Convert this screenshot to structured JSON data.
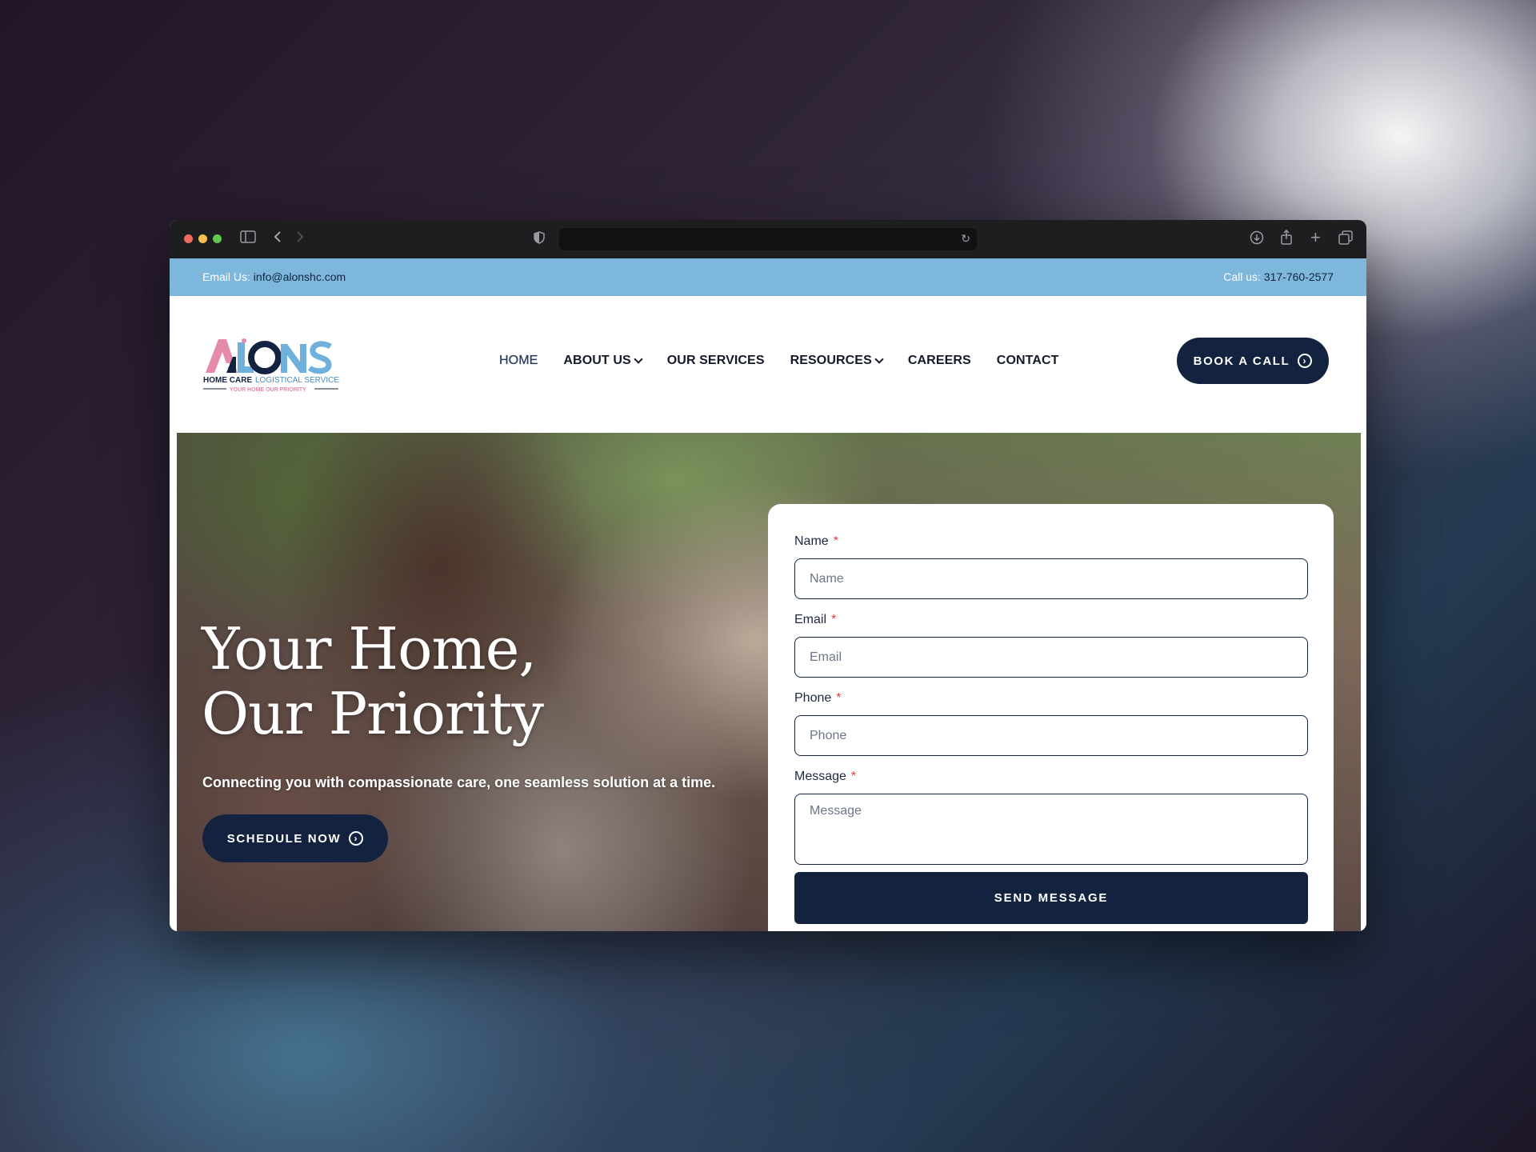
{
  "browser": {
    "traffic_lights": [
      "#ed6a5e",
      "#f5bf4f",
      "#62c554"
    ],
    "icons": [
      "sidebar-icon",
      "back-icon",
      "forward-icon",
      "shield-icon",
      "reload-icon",
      "download-icon",
      "share-icon",
      "new-tab-icon",
      "tabs-overview-icon"
    ]
  },
  "topbar": {
    "email_label": "Email Us:",
    "email_value": "info@alonshc.com",
    "phone_label": "Call us:",
    "phone_value": "317-760-2577",
    "background": "#7db8dc"
  },
  "logo": {
    "word": "ALONS",
    "line1": "HOME CARE LOGISTICAL SERVICES",
    "line2": "YOUR HOME OUR PRIORITY"
  },
  "nav": {
    "items": [
      {
        "label": "HOME",
        "active": true,
        "dropdown": false
      },
      {
        "label": "ABOUT US",
        "active": false,
        "dropdown": true
      },
      {
        "label": "OUR SERVICES",
        "active": false,
        "dropdown": false
      },
      {
        "label": "RESOURCES",
        "active": false,
        "dropdown": true
      },
      {
        "label": "CAREERS",
        "active": false,
        "dropdown": false
      },
      {
        "label": "CONTACT",
        "active": false,
        "dropdown": false
      }
    ],
    "cta_label": "BOOK A CALL"
  },
  "hero": {
    "title_line1": "Your Home,",
    "title_line2": "Our Priority",
    "subtitle": "Connecting you with compassionate care, one seamless solution at a time.",
    "cta_label": "SCHEDULE NOW"
  },
  "form": {
    "name_label": "Name",
    "name_placeholder": "Name",
    "email_label": "Email",
    "email_placeholder": "Email",
    "phone_label": "Phone",
    "phone_placeholder": "Phone",
    "message_label": "Message",
    "message_placeholder": "Message",
    "required_mark": "*",
    "submit_label": "SEND MESSAGE"
  },
  "colors": {
    "navy": "#13233f",
    "accent_pink": "#e58aa8",
    "accent_blue": "#6fb0dc"
  }
}
